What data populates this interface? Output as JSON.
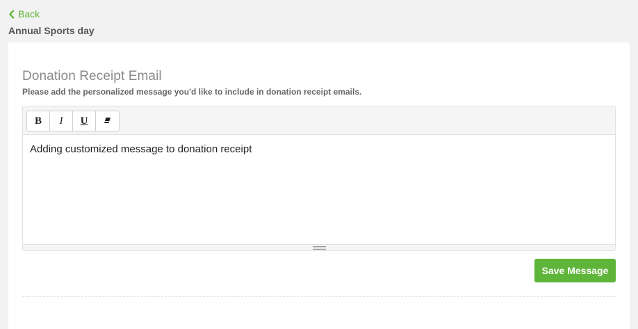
{
  "nav": {
    "back_label": "Back",
    "event_title": "Annual Sports day"
  },
  "receipt_section": {
    "title": "Donation Receipt Email",
    "description": "Please add the personalized message you'd like to include in donation receipt emails."
  },
  "editor": {
    "toolbar": {
      "bold": "B",
      "italic": "I",
      "underline": "U"
    },
    "content": "Adding customized message to donation receipt"
  },
  "actions": {
    "save_label": "Save Message"
  },
  "colors": {
    "accent": "#5fb53a",
    "background": "#f2f2f2"
  },
  "icons": {
    "back": "chevron-left-icon",
    "clear_format": "eraser-icon",
    "resize": "resize-grip-icon"
  }
}
